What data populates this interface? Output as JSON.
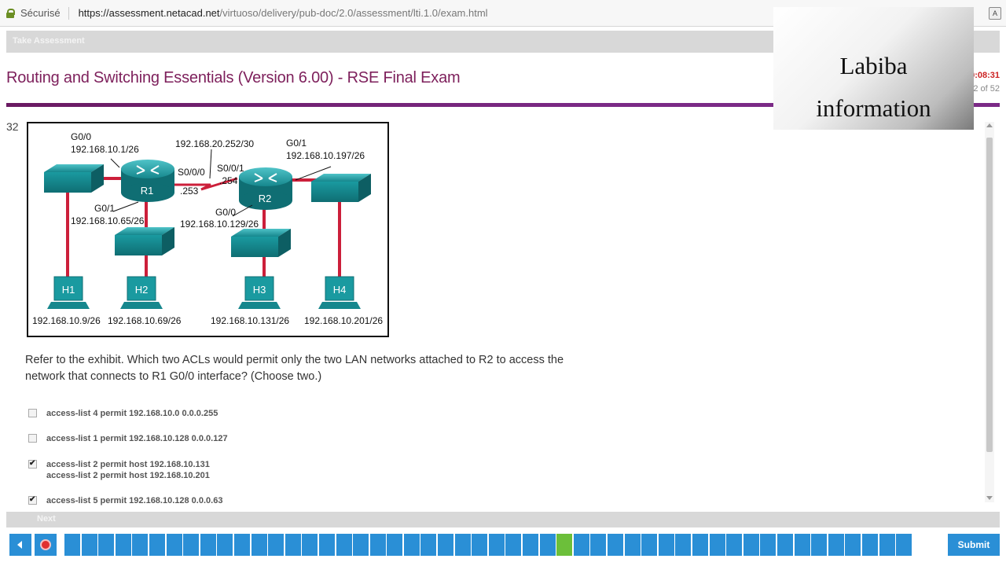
{
  "browser": {
    "secure_label": "Sécurisé",
    "url_host": "https://assessment.netacad.net",
    "url_path": "/virtuoso/delivery/pub-doc/2.0/assessment/lti.1.0/exam.html"
  },
  "header": {
    "take_assessment": "Take Assessment",
    "exam_title": "Routing and Switching Essentials (Version 6.00) - RSE Final Exam",
    "timer": "0:08:31",
    "progress": "32 of 52"
  },
  "watermark": {
    "line1": "Labiba",
    "line2": "information"
  },
  "question": {
    "number": "32",
    "text": "Refer to the exhibit. Which two ACLs would permit only the two LAN networks attached to R2 to access the network that connects to R1 G0/0 interface? (Choose two.)",
    "options": [
      {
        "lines": [
          "access-list 4 permit 192.168.10.0 0.0.0.255"
        ],
        "checked": false
      },
      {
        "lines": [
          "access-list 1 permit 192.168.10.128 0.0.0.127"
        ],
        "checked": false
      },
      {
        "lines": [
          "access-list 2 permit host 192.168.10.131",
          "access-list 2 permit host 192.168.10.201"
        ],
        "checked": true
      },
      {
        "lines": [
          "access-list 5 permit 192.168.10.128 0.0.0.63"
        ],
        "checked": true
      }
    ]
  },
  "exhibit": {
    "r1_g00_label": "G0/0",
    "r1_g00_ip": "192.168.10.1/26",
    "serial_net": "192.168.20.252/30",
    "r1_s000": "S0/0/0",
    "r1_s000_host": ".253",
    "r2_s001": "S0/0/1",
    "r2_s001_host": ".254",
    "r2_g01_label": "G0/1",
    "r2_g01_ip": "192.168.10.197/26",
    "r1_g01_label": "G0/1",
    "r1_g01_ip": "192.168.10.65/26",
    "r2_g00_label": "G0/0",
    "r2_g00_ip": "192.168.10.129/26",
    "r1_name": "R1",
    "r2_name": "R2",
    "h1": "H1",
    "h2": "H2",
    "h3": "H3",
    "h4": "H4",
    "h1_ip": "192.168.10.9/26",
    "h2_ip": "192.168.10.69/26",
    "h3_ip": "192.168.10.131/26",
    "h4_ip": "192.168.10.201/26"
  },
  "footer": {
    "next_label": "Next",
    "submit_label": "Submit",
    "question_count": 52,
    "current_question": 32
  },
  "colors": {
    "title": "#7d1f5b",
    "nav_blue": "#2a8fd6",
    "current_green": "#6cbf3a",
    "link_red": "#cc1f3a",
    "device_teal": "#1a9aa0"
  }
}
